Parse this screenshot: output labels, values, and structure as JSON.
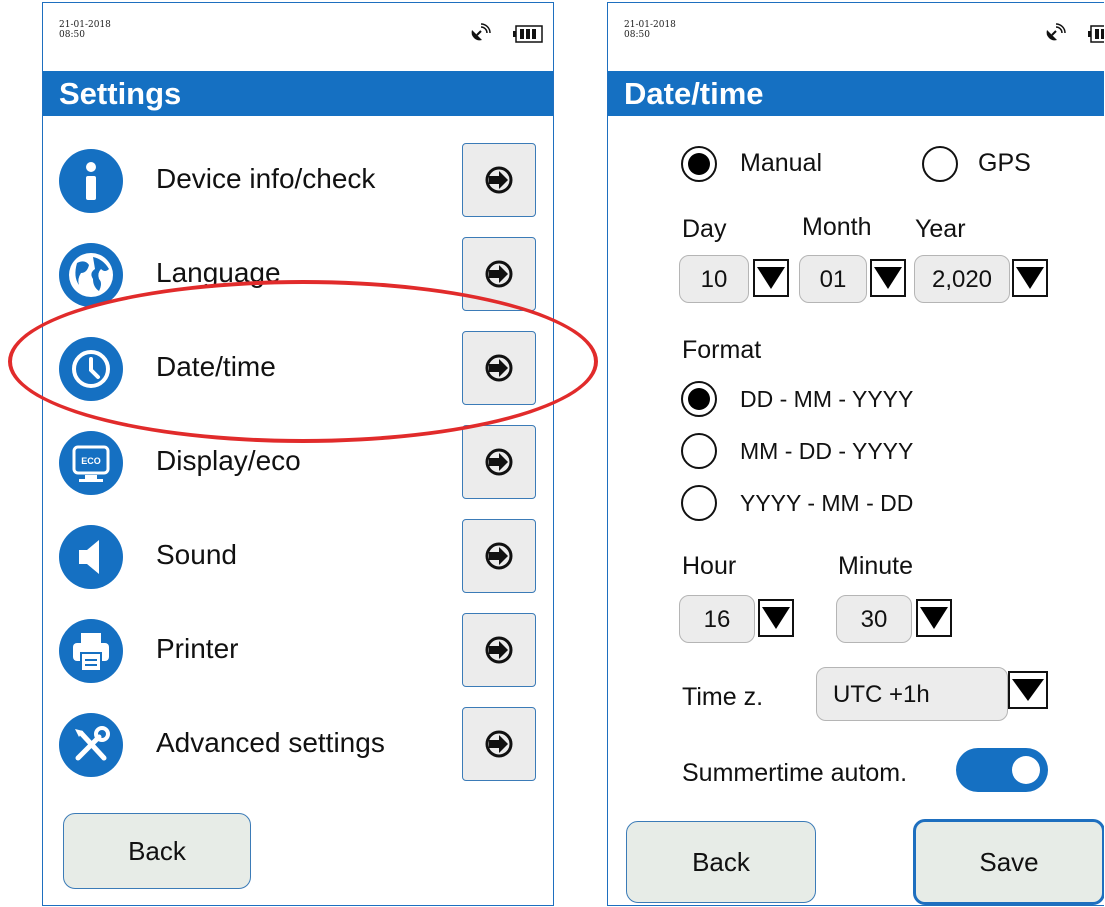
{
  "left_screen": {
    "status": {
      "date": "21-01-2018",
      "time": "08:50",
      "gps_icon": "satellite-dish-icon",
      "battery_icon": "battery-full-icon"
    },
    "title": "Settings",
    "items": [
      {
        "label": "Device info/check",
        "icon": "info-icon"
      },
      {
        "label": "Language",
        "icon": "globe-icon"
      },
      {
        "label": "Date/time",
        "icon": "clock-icon"
      },
      {
        "label": "Display/eco",
        "icon": "eco-monitor-icon"
      },
      {
        "label": "Sound",
        "icon": "speaker-icon"
      },
      {
        "label": "Printer",
        "icon": "printer-icon"
      },
      {
        "label": "Advanced settings",
        "icon": "tools-icon"
      }
    ],
    "highlighted_item": "Date/time",
    "back_label": "Back"
  },
  "right_screen": {
    "status": {
      "date": "21-01-2018",
      "time": "08:50"
    },
    "title": "Date/time",
    "source": {
      "manual_label": "Manual",
      "gps_label": "GPS",
      "selected": "Manual"
    },
    "date_labels": {
      "day": "Day",
      "month": "Month",
      "year": "Year"
    },
    "date_values": {
      "day": "10",
      "month": "01",
      "year": "2,020"
    },
    "format": {
      "label": "Format",
      "options": [
        "DD - MM - YYYY",
        "MM - DD - YYYY",
        "YYYY - MM - DD"
      ],
      "selected": "DD - MM - YYYY"
    },
    "time_labels": {
      "hour": "Hour",
      "minute": "Minute"
    },
    "time_values": {
      "hour": "16",
      "minute": "30"
    },
    "timezone": {
      "label": "Time z.",
      "value": "UTC +1h"
    },
    "summertime": {
      "label": "Summertime autom.",
      "enabled": true
    },
    "back_label": "Back",
    "save_label": "Save"
  },
  "colors": {
    "accent": "#1570c2",
    "highlight_ring": "#e12b2b",
    "button_bg": "#e7ece7"
  }
}
